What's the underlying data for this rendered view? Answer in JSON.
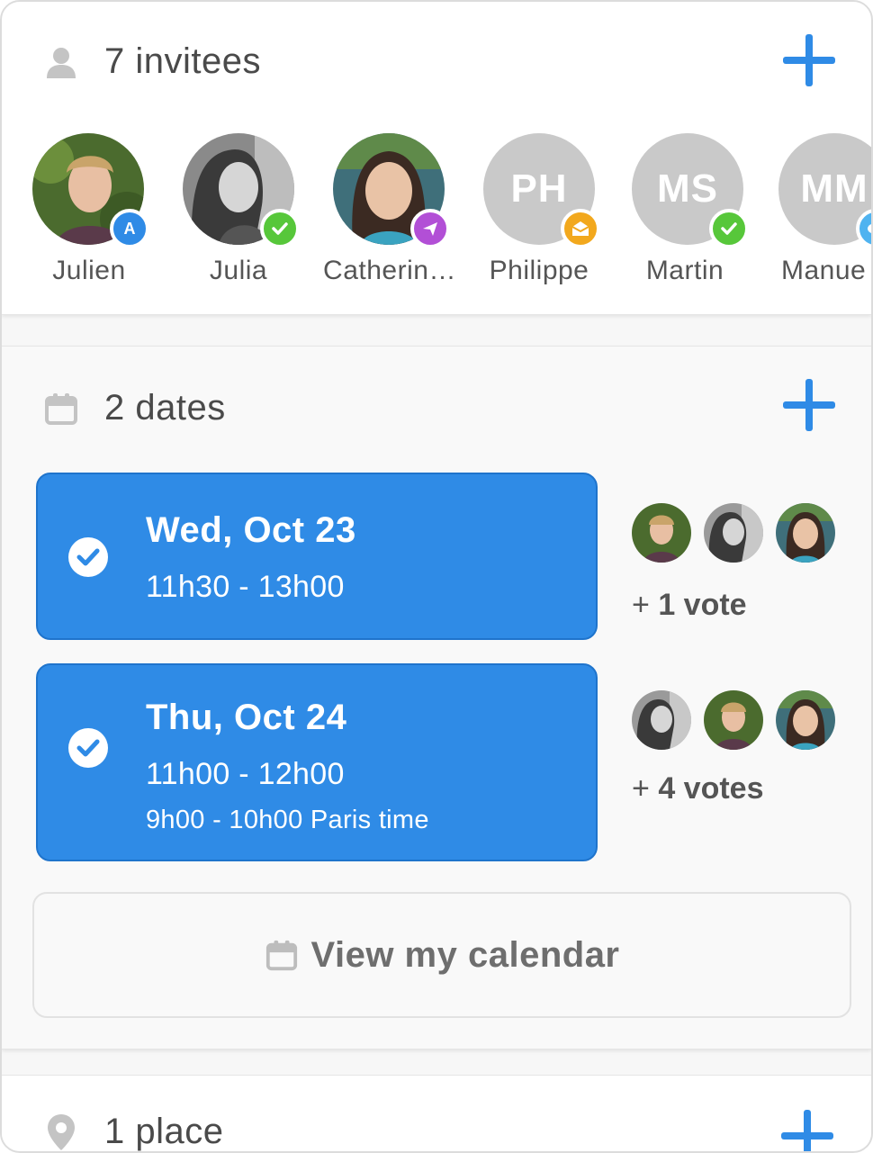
{
  "invitees": {
    "title": "7 invitees",
    "people": [
      {
        "name": "Julien",
        "initials": "",
        "badge": "A",
        "badge_color": "#2f8be6",
        "photo": true
      },
      {
        "name": "Julia",
        "initials": "",
        "badge": "check-icon",
        "badge_color": "#57c73a",
        "photo": true
      },
      {
        "name": "Catherin…",
        "initials": "",
        "badge": "paper-plane-icon",
        "badge_color": "#b24fd6",
        "photo": true
      },
      {
        "name": "Philippe",
        "initials": "PH",
        "badge": "envelope-open-icon",
        "badge_color": "#f2a81d",
        "photo": false
      },
      {
        "name": "Martin",
        "initials": "MS",
        "badge": "check-icon",
        "badge_color": "#57c73a",
        "photo": false
      },
      {
        "name": "Manue",
        "initials": "MM",
        "badge": "eye-icon",
        "badge_color": "#4fb3f0",
        "photo": false
      }
    ]
  },
  "dates": {
    "title": "2 dates",
    "options": [
      {
        "day": "Wed, Oct 23",
        "time": "11h30 - 13h00",
        "alt_time": "",
        "votes_prefix": "+",
        "votes": "1 vote"
      },
      {
        "day": "Thu, Oct 24",
        "time": "11h00 - 12h00",
        "alt_time": "9h00 - 10h00 Paris time",
        "votes_prefix": "+",
        "votes": "4 votes"
      }
    ],
    "calendar_button": "View my calendar"
  },
  "place": {
    "title": "1 place"
  },
  "colors": {
    "accent": "#2f8be6",
    "accepted": "#57c73a"
  }
}
